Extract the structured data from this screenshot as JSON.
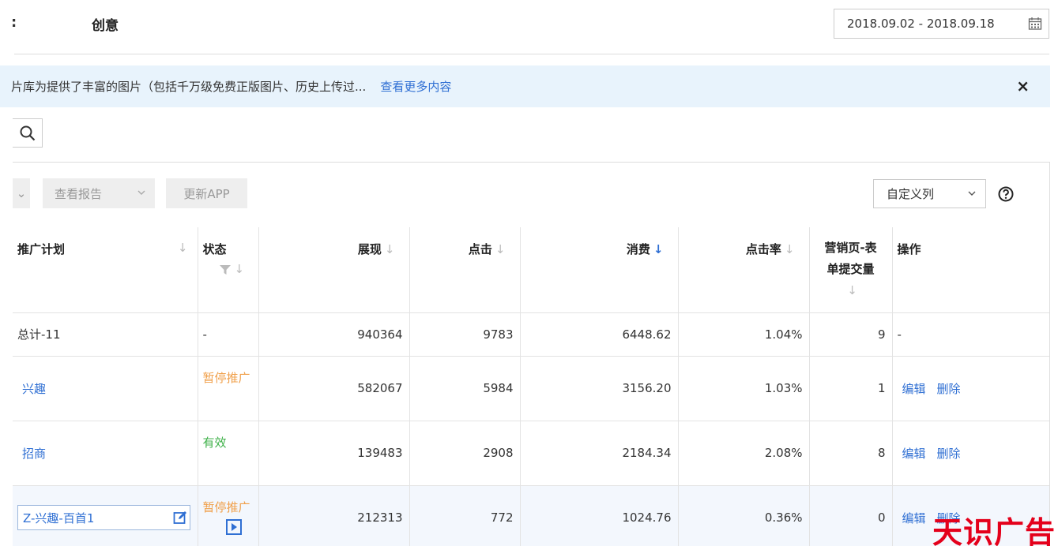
{
  "header": {
    "left_fragment": ":",
    "title": "创意",
    "date_range": "2018.09.02 - 2018.09.18"
  },
  "notice": {
    "text": "片库为提供了丰富的图片（包括千万级免费正版图片、历史上传过...",
    "more_link": "查看更多内容",
    "close_glyph": "×"
  },
  "toolbar": {
    "first_chevron": "⌄",
    "report_label": "查看报告",
    "update_label": "更新APP",
    "custom_columns_label": "自定义列"
  },
  "table": {
    "headers": {
      "plan": "推广计划",
      "status": "状态",
      "impressions": "展现",
      "clicks": "点击",
      "spend": "消费",
      "ctr": "点击率",
      "conversions_line1": "营销页-表",
      "conversions_line2": "单提交量",
      "ops": "操作"
    },
    "total": {
      "plan": "总计-11",
      "status": "-",
      "impressions": "940364",
      "clicks": "9783",
      "spend": "6448.62",
      "ctr": "1.04%",
      "conversions": "9",
      "ops": "-"
    },
    "rows": [
      {
        "plan": "兴趣",
        "status": "暂停推广",
        "impressions": "582067",
        "clicks": "5984",
        "spend": "3156.20",
        "ctr": "1.03%",
        "conversions": "1",
        "edit": "编辑",
        "delete": "删除"
      },
      {
        "plan": "招商",
        "status": "有效",
        "impressions": "139483",
        "clicks": "2908",
        "spend": "2184.34",
        "ctr": "2.08%",
        "conversions": "8",
        "edit": "编辑",
        "delete": "删除"
      },
      {
        "plan": "Z-兴趣-百首1",
        "status": "暂停推广",
        "impressions": "212313",
        "clicks": "772",
        "spend": "1024.76",
        "ctr": "0.36%",
        "conversions": "0",
        "edit": "编辑",
        "delete": "删除"
      }
    ]
  },
  "watermark": "天识广告",
  "colors": {
    "link": "#2f6fd3",
    "paused": "#f0a04b",
    "active": "#3fb14a",
    "banner_bg": "#e8f3fc"
  }
}
